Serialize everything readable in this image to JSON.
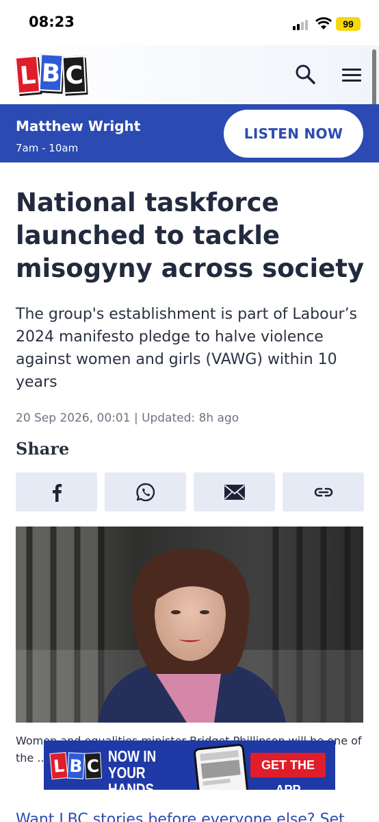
{
  "status_bar": {
    "time": "08:23",
    "battery": "99"
  },
  "header": {
    "logo_text": [
      "L",
      "B",
      "C"
    ]
  },
  "live": {
    "presenter": "Matthew Wright",
    "time": "7am - 10am",
    "listen_label": "LISTEN NOW"
  },
  "article": {
    "headline": "National taskforce launched to tackle misogyny across society",
    "standfirst": "The group's establishment is part of Labour’s 2024 manifesto pledge to halve violence against women and girls (VAWG) within 10 years",
    "dateline": "20 Sep 2026, 00:01 | Updated: 8h ago",
    "share_heading": "Share",
    "caption": "Women and equalities minister Bridget Phillipson will be one of the ... prob..."
  },
  "share_buttons": [
    {
      "name": "facebook",
      "icon": "facebook-icon"
    },
    {
      "name": "whatsapp",
      "icon": "whatsapp-icon"
    },
    {
      "name": "email",
      "icon": "mail-icon"
    },
    {
      "name": "copy-link",
      "icon": "link-icon"
    }
  ],
  "app_banner": {
    "tagline_line1": "NOW IN",
    "tagline_line2": "YOUR HANDS.",
    "cta": "GET THE APP"
  },
  "promo_link": "Want LBC stories before everyone else? Set",
  "colors": {
    "brand_blue": "#2b4bb3",
    "brand_red": "#e01d2a",
    "share_bg": "#e6eaf5",
    "battery": "#f5d90a"
  }
}
